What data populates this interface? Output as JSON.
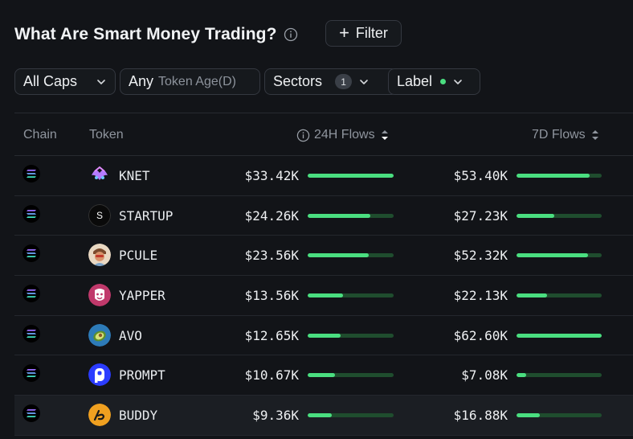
{
  "header": {
    "title": "What Are Smart Money Trading?",
    "filter_label": "Filter"
  },
  "filters": {
    "caps": "All Caps",
    "age_prefix": "Any",
    "age_label": "Token Age(D)",
    "sectors": "Sectors",
    "sectors_count": "1",
    "label": "Label"
  },
  "columns": {
    "chain": "Chain",
    "token": "Token",
    "flows24h": "24H Flows",
    "flows7d": "7D Flows"
  },
  "colors": {
    "accent": "#4ade80",
    "bar_track": "#1f4d2e",
    "background": "#121418"
  },
  "rows": [
    {
      "name": "KNET",
      "icon": "knet-icon",
      "flow24h": "$33.42K",
      "fill24h": 1.0,
      "flow7d": "$53.40K",
      "fill7d": 0.86
    },
    {
      "name": "STARTUP",
      "icon": "startup-icon",
      "glyph": "S",
      "flow24h": "$24.26K",
      "fill24h": 0.73,
      "flow7d": "$27.23K",
      "fill7d": 0.44
    },
    {
      "name": "PCULE",
      "icon": "pcule-icon",
      "flow24h": "$23.56K",
      "fill24h": 0.71,
      "flow7d": "$52.32K",
      "fill7d": 0.84
    },
    {
      "name": "YAPPER",
      "icon": "yapper-icon",
      "flow24h": "$13.56K",
      "fill24h": 0.41,
      "flow7d": "$22.13K",
      "fill7d": 0.36
    },
    {
      "name": "AVO",
      "icon": "avo-icon",
      "flow24h": "$12.65K",
      "fill24h": 0.38,
      "flow7d": "$62.60K",
      "fill7d": 1.0
    },
    {
      "name": "PROMPT",
      "icon": "prompt-icon",
      "flow24h": "$10.67K",
      "fill24h": 0.32,
      "flow7d": "$7.08K",
      "fill7d": 0.11
    },
    {
      "name": "BUDDY",
      "icon": "buddy-icon",
      "flow24h": "$9.36K",
      "fill24h": 0.28,
      "flow7d": "$16.88K",
      "fill7d": 0.27
    }
  ]
}
